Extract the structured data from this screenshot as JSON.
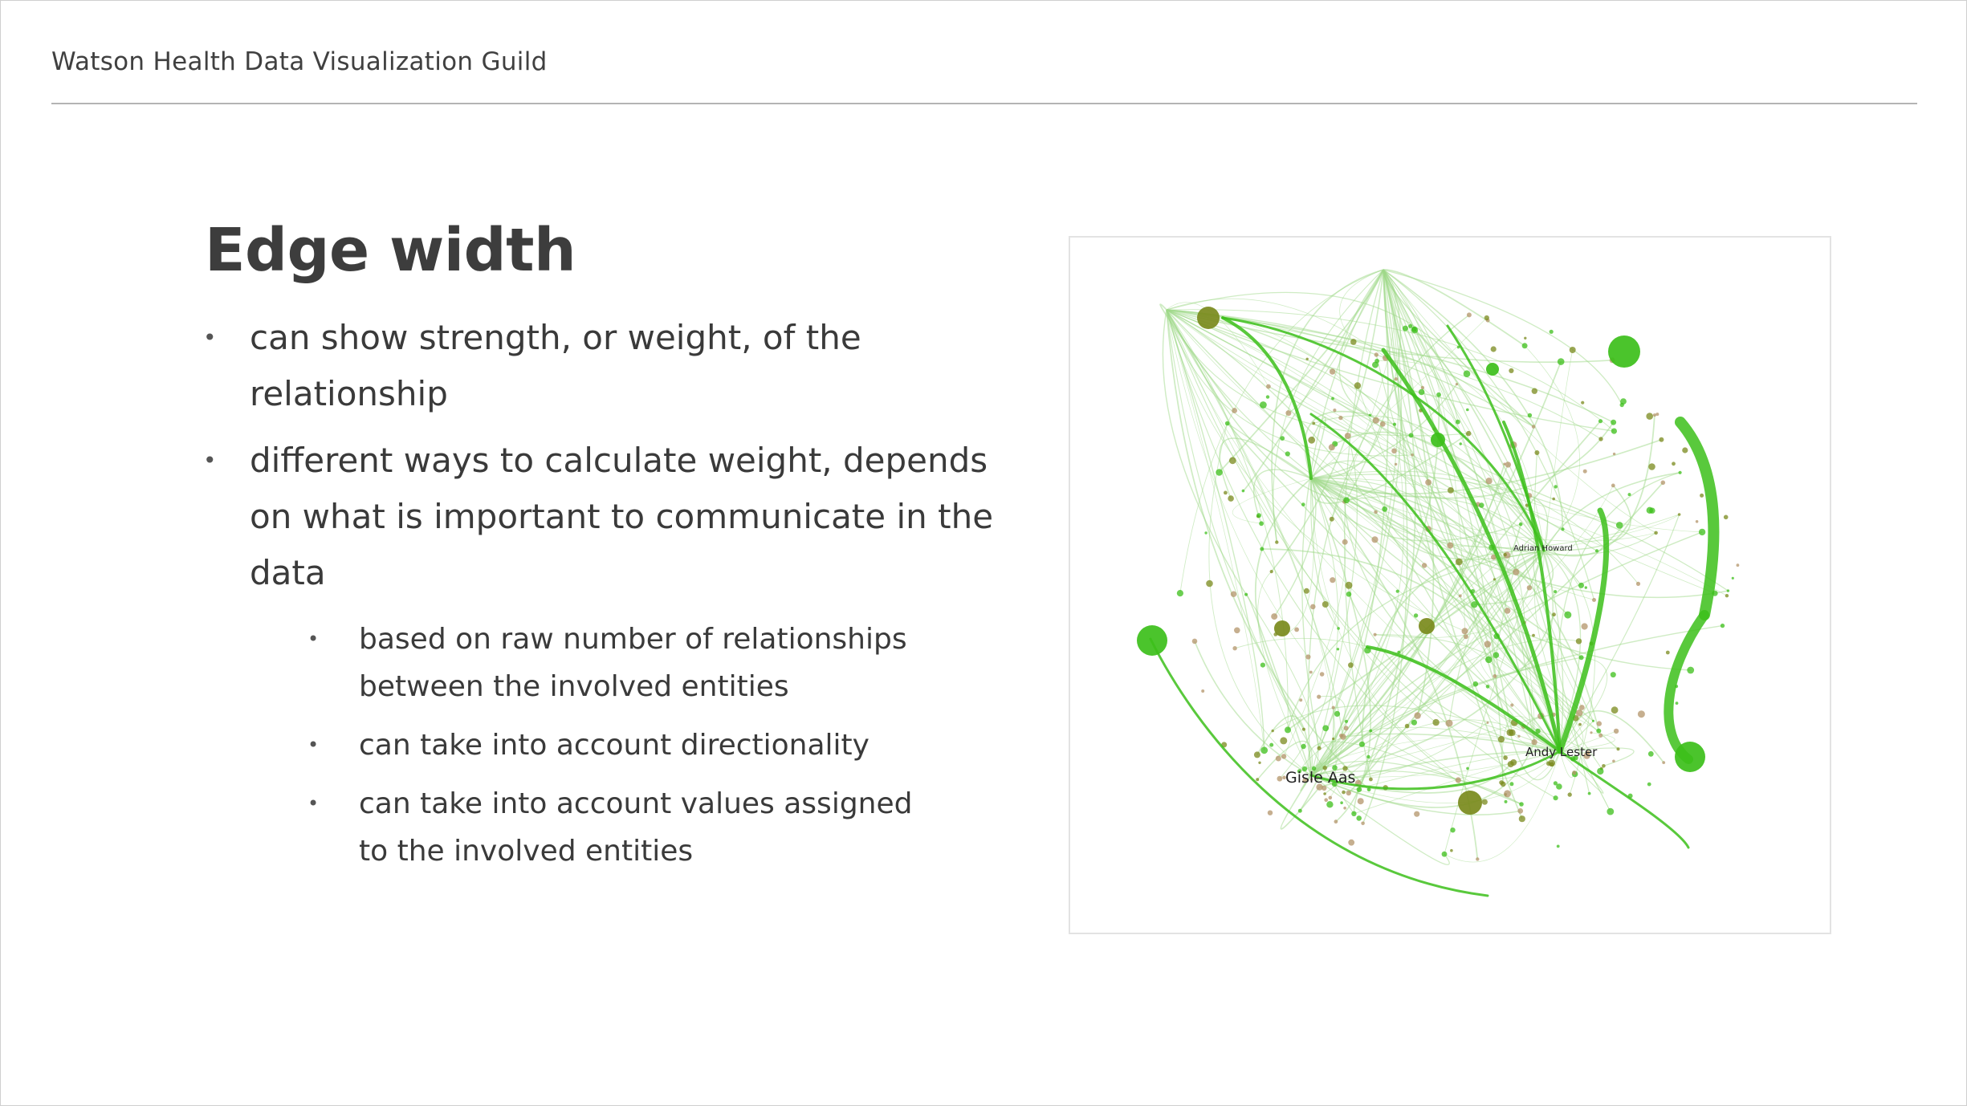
{
  "header": {
    "title": "Watson Health Data Visualization Guild"
  },
  "slide": {
    "title": "Edge width",
    "bullets": [
      "can show strength, or weight, of the relationship",
      "different ways to calculate weight, depends on what is important to communicate in the data"
    ],
    "subbullets": [
      "based on raw number of relationships between the involved entities",
      "can take into account directionality",
      "can take into account values assigned to the involved entities"
    ]
  },
  "figure": {
    "labels": {
      "andy": "Andy Lester",
      "gisle": "Gisle Aas",
      "adrian": "Adrian Howard"
    },
    "colors": {
      "bright_green": "#3cbf1a",
      "pale_green": "#9fd98a",
      "olive": "#7a8a1c",
      "tan": "#b3946a"
    }
  }
}
